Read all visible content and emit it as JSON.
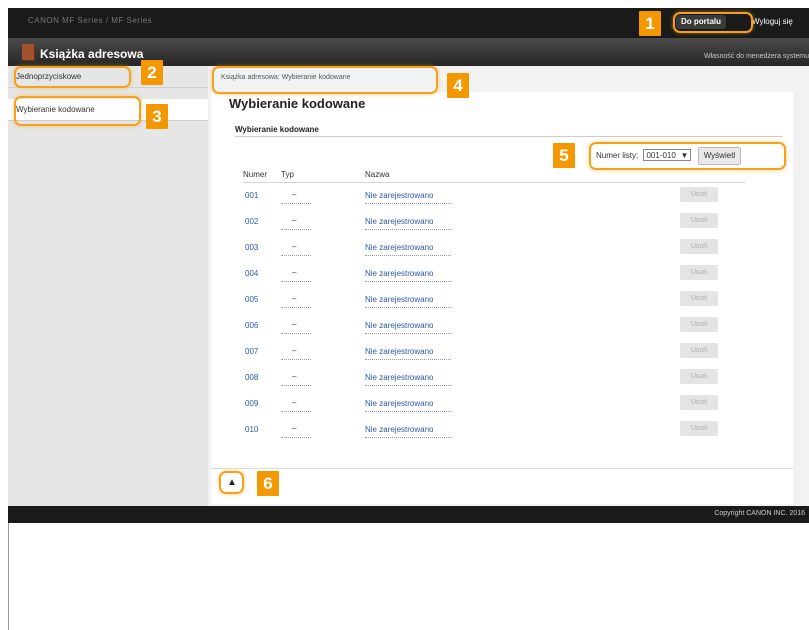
{
  "topbar": {
    "device": "CANON MF Series / MF Series"
  },
  "header": {
    "portal_button": "Do portalu",
    "logout_button": "Wyloguj się",
    "title": "Książka adresowa",
    "permission": "Własność do menedżera systemu"
  },
  "sidebar": {
    "items": [
      {
        "label": "Jednoprzyciskowe"
      },
      {
        "label": "Wybieranie kodowane"
      }
    ]
  },
  "main": {
    "breadcrumb": "Książka adresowa: Wybieranie kodowane",
    "page_title": "Wybieranie kodowane",
    "section_title": "Wybieranie kodowane",
    "list_number_label": "Numer listy:",
    "list_number_value": "001-010",
    "display_button": "Wyświetl",
    "columns": {
      "number": "Numer",
      "type": "Typ",
      "name": "Nazwa",
      "delete": "Usuń"
    },
    "rows": [
      {
        "number": "001",
        "type": "–",
        "name": "Nie zarejestrowano",
        "action": "Usuń"
      },
      {
        "number": "002",
        "type": "–",
        "name": "Nie zarejestrowano",
        "action": "Usuń"
      },
      {
        "number": "003",
        "type": "–",
        "name": "Nie zarejestrowano",
        "action": "Usuń"
      },
      {
        "number": "004",
        "type": "–",
        "name": "Nie zarejestrowano",
        "action": "Usuń"
      },
      {
        "number": "005",
        "type": "–",
        "name": "Nie zarejestrowano",
        "action": "Usuń"
      },
      {
        "number": "006",
        "type": "–",
        "name": "Nie zarejestrowano",
        "action": "Usuń"
      },
      {
        "number": "007",
        "type": "–",
        "name": "Nie zarejestrowano",
        "action": "Usuń"
      },
      {
        "number": "008",
        "type": "–",
        "name": "Nie zarejestrowano",
        "action": "Usuń"
      },
      {
        "number": "009",
        "type": "–",
        "name": "Nie zarejestrowano",
        "action": "Usuń"
      },
      {
        "number": "010",
        "type": "–",
        "name": "Nie zarejestrowano",
        "action": "Usuń"
      }
    ],
    "back_to_top_icon": "▲"
  },
  "footer": {
    "copyright": "Copyright CANON INC. 2016"
  },
  "callouts": [
    "1",
    "2",
    "3",
    "4",
    "5",
    "6"
  ],
  "colors": {
    "accent": "#f39800",
    "link": "#2a5aa8",
    "topbar": "#1a1a1a"
  }
}
